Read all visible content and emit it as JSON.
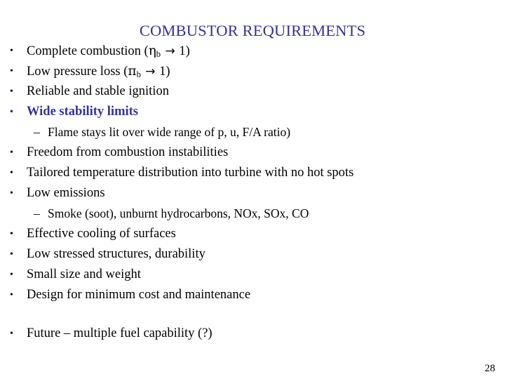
{
  "slide": {
    "title": "COMBUSTOR REQUIREMENTS",
    "page_number": "28",
    "title_color": "#333399",
    "highlight_color": "#333399",
    "body_color": "#000000",
    "background_color": "#ffffff",
    "bullet_marker": "•",
    "dash_marker": "–",
    "items": [
      {
        "level": 1,
        "prefix": "Complete combustion (",
        "symbol": "η",
        "subscript": "b",
        "arrow": "→",
        "suffix": " 1)",
        "highlight": false
      },
      {
        "level": 1,
        "prefix": "Low pressure loss (",
        "symbol": "π",
        "subscript": "b",
        "arrow": "→",
        "suffix": " 1)",
        "highlight": false
      },
      {
        "level": 1,
        "text": "Reliable and stable ignition",
        "highlight": false
      },
      {
        "level": 1,
        "text": "Wide stability limits",
        "highlight": true
      },
      {
        "level": 2,
        "text": "Flame stays lit over wide range of p, u, F/A ratio)",
        "highlight": false
      },
      {
        "level": 1,
        "text": "Freedom from combustion instabilities",
        "highlight": false
      },
      {
        "level": 1,
        "text": "Tailored temperature distribution into turbine with no hot spots",
        "highlight": false
      },
      {
        "level": 1,
        "text": "Low emissions",
        "highlight": false
      },
      {
        "level": 2,
        "text": "Smoke (soot), unburnt hydrocarbons, NOx, SOx, CO",
        "highlight": false
      },
      {
        "level": 1,
        "text": "Effective cooling of surfaces",
        "highlight": false
      },
      {
        "level": 1,
        "text": "Low stressed structures, durability",
        "highlight": false
      },
      {
        "level": 1,
        "text": "Small size and weight",
        "highlight": false
      },
      {
        "level": 1,
        "text": "Design for minimum cost and maintenance",
        "highlight": false
      },
      {
        "level": 0,
        "text": "",
        "spacer": true
      },
      {
        "level": 1,
        "text": "Future – multiple fuel capability (?)",
        "highlight": false
      }
    ]
  }
}
